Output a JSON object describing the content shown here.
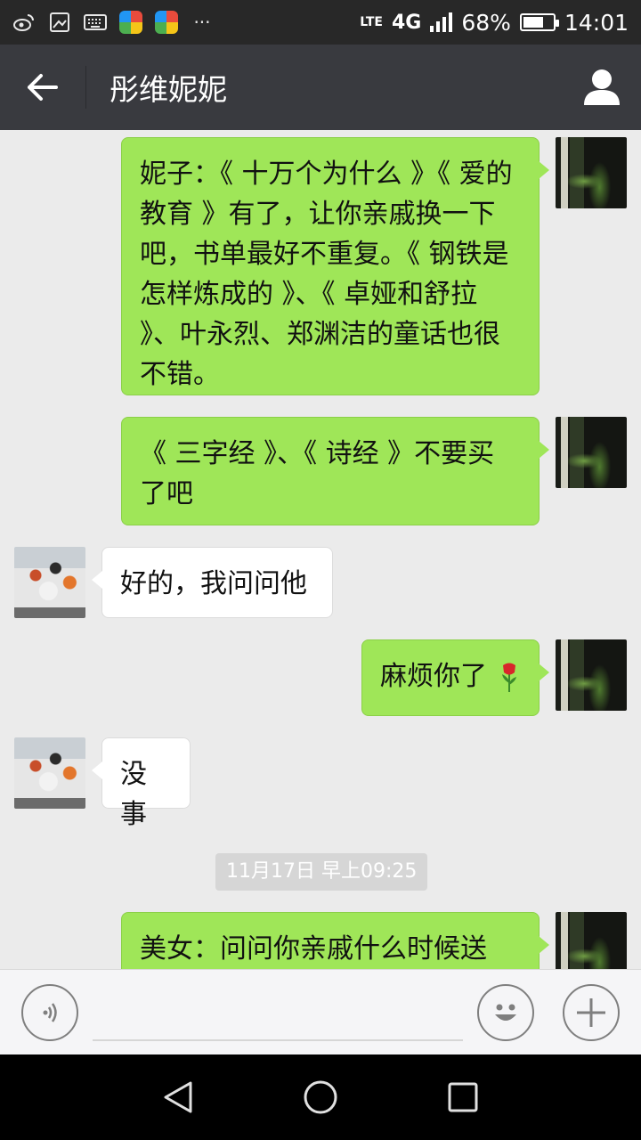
{
  "status_bar": {
    "network_small": "LTE",
    "network_type": "4G",
    "network_small_2": "LTE",
    "battery_percent": "68%",
    "battery_level": 0.68,
    "time": "14:01"
  },
  "header": {
    "title": "彤维妮妮"
  },
  "messages": [
    {
      "from": "me",
      "text": "妮子：《 十万个为什么 》《 爱的教育 》有了，让你亲戚换一下吧，书单最好不重复。《 钢铁是怎样炼成的 》、《 卓娅和舒拉 》、叶永烈、郑渊洁的童话也很不错。"
    },
    {
      "from": "me",
      "text": "《 三字经 》、《 诗经 》不要买了吧"
    },
    {
      "from": "friend",
      "text": "好的，我问问他"
    },
    {
      "from": "me",
      "text": "麻烦你了"
    },
    {
      "from": "friend",
      "text": "没事"
    },
    {
      "timestamp": "11月17日 早上09:25"
    },
    {
      "from": "me",
      "text": "美女：问问你亲戚什么时候送"
    }
  ],
  "icons": {
    "back": "arrow-left-icon",
    "contact": "person-icon",
    "voice": "voice-icon",
    "emoji": "emoji-icon",
    "more": "plus-icon",
    "rose": "rose-icon"
  },
  "colors": {
    "sent_bubble": "#9fe658",
    "recv_bubble": "#ffffff",
    "header_bg": "#393a3f",
    "chat_bg": "#ebebeb"
  }
}
